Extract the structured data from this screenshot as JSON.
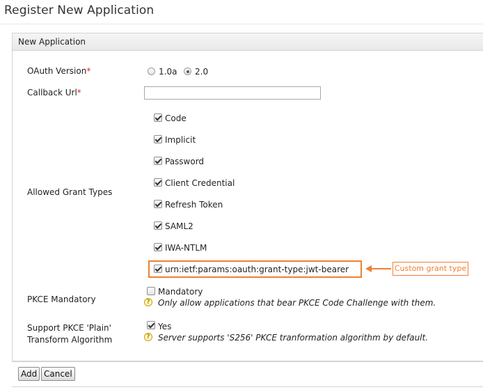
{
  "page": {
    "title": "Register New Application"
  },
  "panel": {
    "header": "New Application"
  },
  "oauth_version": {
    "label": "OAuth Version",
    "required_mark": "*",
    "options": [
      {
        "label": "1.0a",
        "selected": false
      },
      {
        "label": "2.0",
        "selected": true
      }
    ]
  },
  "callback_url": {
    "label": "Callback Url",
    "required_mark": "*",
    "value": "",
    "placeholder": ""
  },
  "grant_types": {
    "label": "Allowed Grant Types",
    "items": [
      {
        "label": "Code",
        "checked": true
      },
      {
        "label": "Implicit",
        "checked": true
      },
      {
        "label": "Password",
        "checked": true
      },
      {
        "label": "Client Credential",
        "checked": true
      },
      {
        "label": "Refresh Token",
        "checked": true
      },
      {
        "label": "SAML2",
        "checked": true
      },
      {
        "label": "IWA-NTLM",
        "checked": true
      },
      {
        "label": "urn:ietf:params:oauth:grant-type:jwt-bearer",
        "checked": true
      }
    ],
    "callout": "Custom grant type",
    "highlight_color": "#ef7f31"
  },
  "pkce_mandatory": {
    "label": "PKCE Mandatory",
    "checkbox_label": "Mandatory",
    "checked": false,
    "hint": "Only allow applications that bear PKCE Code Challenge with them."
  },
  "pkce_plain": {
    "label_line1": "Support PKCE 'Plain'",
    "label_line2": "Transform Algorithm",
    "checkbox_label": "Yes",
    "checked": true,
    "hint": "Server supports 'S256' PKCE tranformation algorithm by default."
  },
  "actions": {
    "add_label": "Add",
    "cancel_label": "Cancel"
  },
  "colors": {
    "required": "#e52525",
    "help_icon": "#c9a000"
  }
}
